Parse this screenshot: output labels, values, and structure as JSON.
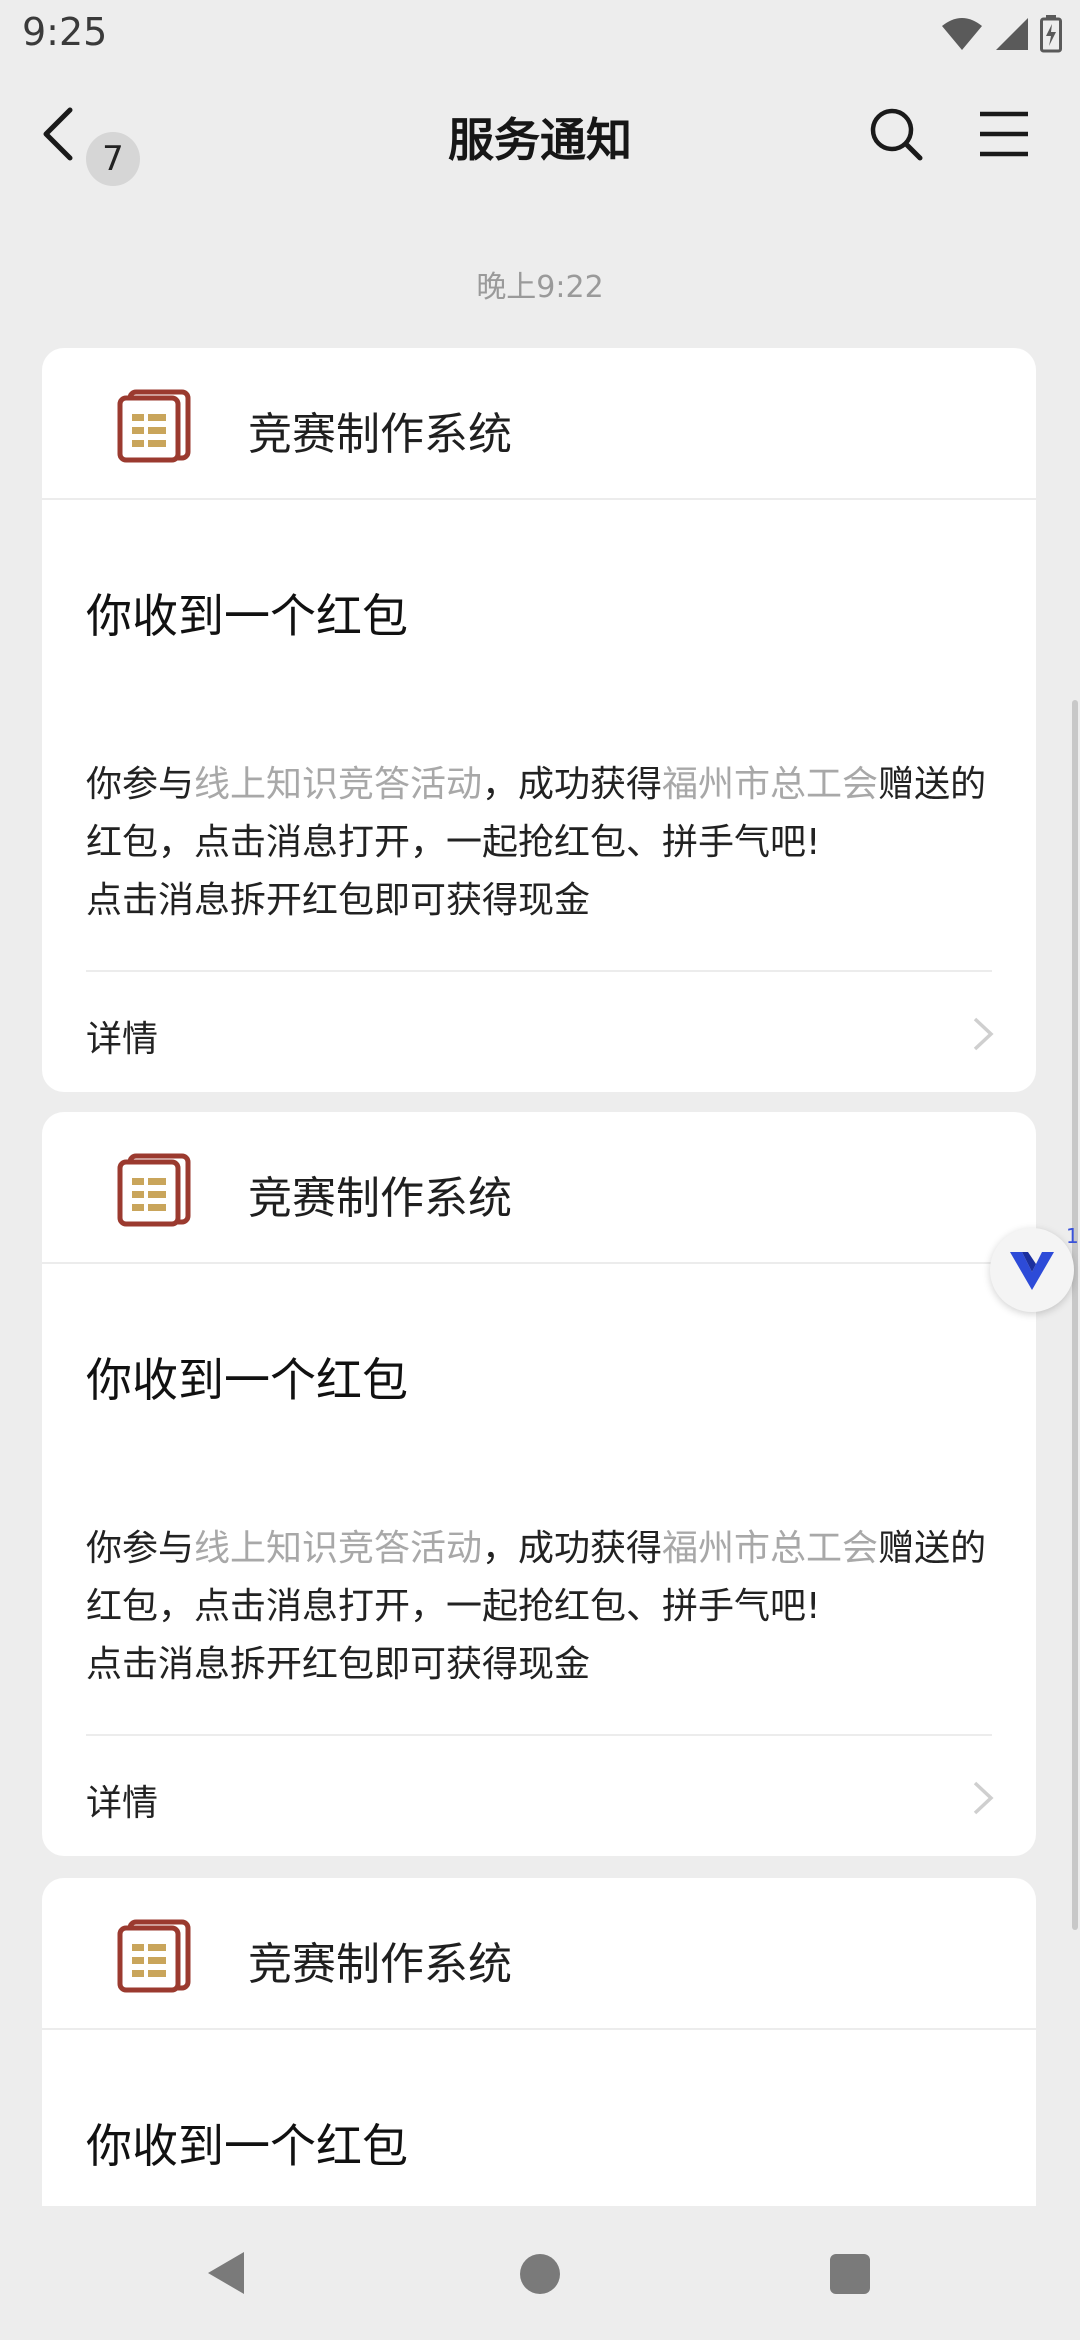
{
  "status_bar": {
    "time": "9:25"
  },
  "header": {
    "badge_count": "7",
    "title": "服务通知"
  },
  "timestamp": "晚上9:22",
  "cards": [
    {
      "app_name": "竞赛制作系统",
      "title": "你收到一个红包",
      "body": {
        "p1": "你参与",
        "link1": "线上知识竞答活动",
        "p2": "，成功获得",
        "link2": "福州市总工会",
        "p3": "赠送的红包，点击消息打开，一起抢红包、拼手气吧!",
        "p4": "点击消息拆开红包即可获得现金"
      },
      "details_label": "详情"
    },
    {
      "app_name": "竞赛制作系统",
      "title": "你收到一个红包",
      "body": {
        "p1": "你参与",
        "link1": "线上知识竞答活动",
        "p2": "，成功获得",
        "link2": "福州市总工会",
        "p3": "赠送的红包，点击消息打开，一起抢红包、拼手气吧!",
        "p4": "点击消息拆开红包即可获得现金"
      },
      "details_label": "详情"
    },
    {
      "app_name": "竞赛制作系统",
      "title": "你收到一个红包"
    }
  ],
  "floating_widget": {
    "count": "1"
  },
  "colors": {
    "background": "#ededed",
    "card": "#ffffff",
    "muted_link": "#a8a8a8",
    "icon_red": "#9b3a2f",
    "icon_gold": "#c9a55b"
  }
}
